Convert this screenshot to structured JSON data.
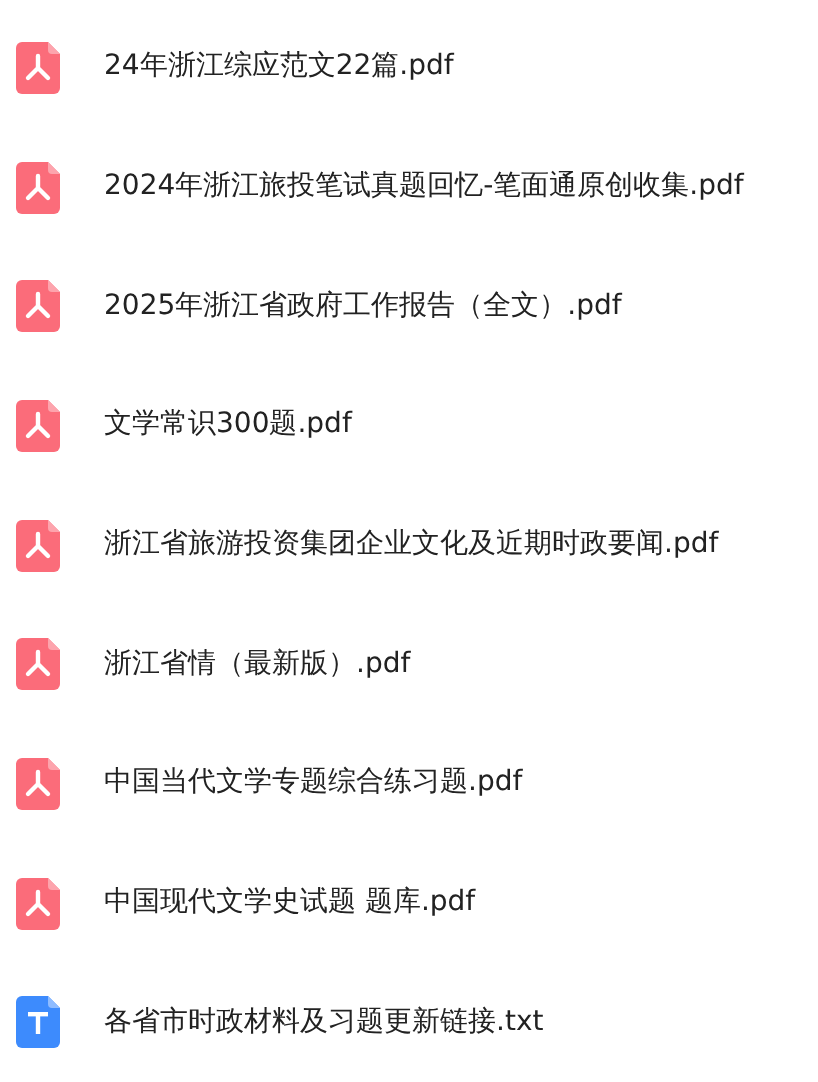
{
  "files": [
    {
      "name": "24年浙江综应范文22篇.pdf",
      "kind": "pdf"
    },
    {
      "name": "2024年浙江旅投笔试真题回忆-笔面通原创收集.pdf",
      "kind": "pdf"
    },
    {
      "name": "2025年浙江省政府工作报告（全文）.pdf",
      "kind": "pdf"
    },
    {
      "name": "文学常识300题.pdf",
      "kind": "pdf"
    },
    {
      "name": "浙江省旅游投资集团企业文化及近期时政要闻.pdf",
      "kind": "pdf"
    },
    {
      "name": "浙江省情（最新版）.pdf",
      "kind": "pdf"
    },
    {
      "name": "中国当代文学专题综合练习题.pdf",
      "kind": "pdf"
    },
    {
      "name": "中国现代文学史试题 题库.pdf",
      "kind": "pdf"
    },
    {
      "name": "各省市时政材料及习题更新链接.txt",
      "kind": "txt"
    }
  ]
}
